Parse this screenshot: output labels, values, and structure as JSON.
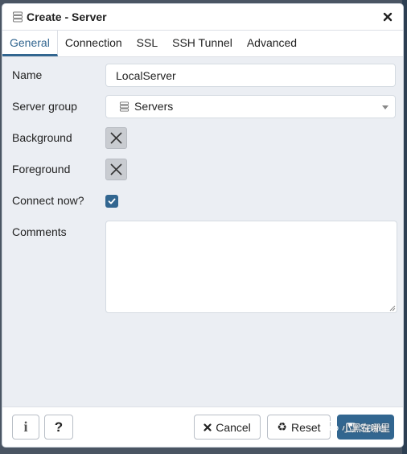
{
  "dialog": {
    "title": "Create - Server"
  },
  "tabs": [
    {
      "label": "General",
      "active": true
    },
    {
      "label": "Connection",
      "active": false
    },
    {
      "label": "SSL",
      "active": false
    },
    {
      "label": "SSH Tunnel",
      "active": false
    },
    {
      "label": "Advanced",
      "active": false
    }
  ],
  "form": {
    "name_label": "Name",
    "name_value": "LocalServer",
    "server_group_label": "Server group",
    "server_group_value": "Servers",
    "background_label": "Background",
    "foreground_label": "Foreground",
    "connect_now_label": "Connect now?",
    "connect_now_checked": true,
    "comments_label": "Comments",
    "comments_value": ""
  },
  "footer": {
    "info_label": "i",
    "help_label": "?",
    "cancel_label": "Cancel",
    "reset_label": "Reset",
    "save_label": "Save"
  },
  "watermark": {
    "text": "小黑在哪里"
  },
  "colors": {
    "accent": "#326690",
    "dialog_bg": "#ebeef3",
    "swatch": "#c9ccd1"
  },
  "icons": {
    "title": "server-group-icon",
    "close": "close-icon",
    "server_group": "server-group-icon",
    "cancel": "x-icon",
    "reset": "recycle-icon",
    "save": "floppy-disk-icon"
  }
}
